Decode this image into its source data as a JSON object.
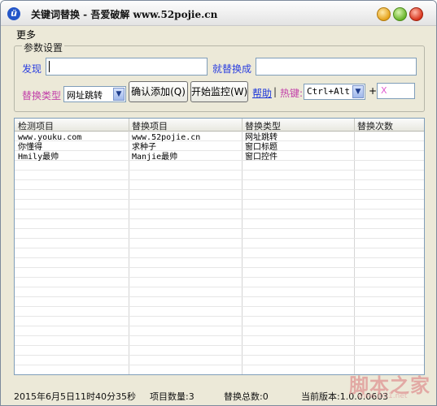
{
  "window": {
    "title": "关键词替换 - 吾爱破解 www.52pojie.cn",
    "app_icon_glyph": "ü"
  },
  "menu": {
    "more_label": "更多"
  },
  "params": {
    "group_title": "参数设置",
    "find_label": "发现",
    "find_value": "",
    "replace_label": "就替换成",
    "replace_value": "",
    "type_label": "替换类型",
    "type_selected": "网址跳转",
    "confirm_add_label": "确认添加(Q)",
    "start_monitor_label": "开始监控(W)",
    "help_label": "帮助",
    "separator": "|",
    "hotkey_label": "热键:",
    "hotkey_selected": "Ctrl+Alt",
    "plus": "+",
    "hotkey_key": "X"
  },
  "grid": {
    "columns": [
      "检测项目",
      "替换项目",
      "替换类型",
      "替换次数"
    ],
    "rows": [
      [
        "www.youku.com",
        "www.52pojie.cn",
        "网址跳转",
        ""
      ],
      [
        "你懂得",
        "求种子",
        "窗口标题",
        ""
      ],
      [
        "Hmily最帅",
        "Manjie最帅",
        "窗口控件",
        ""
      ]
    ]
  },
  "status": {
    "datetime": "2015年6月5日11时40分35秒",
    "item_count": "项目数量:3",
    "replace_total": "替换总数:0",
    "version": "当前版本:1.0.0.0603"
  },
  "watermark": {
    "text": "脚本之家",
    "url": "www.jb51.net"
  },
  "colors": {
    "label_blue": "#2a3ee0",
    "label_magenta": "#c23fa9",
    "link_blue": "#1a35d9"
  }
}
